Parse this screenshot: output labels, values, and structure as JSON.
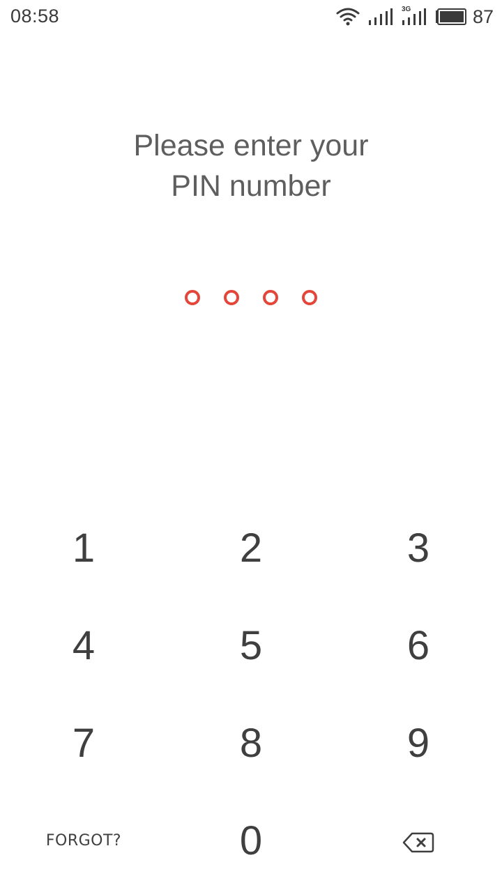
{
  "status_bar": {
    "time": "08:58",
    "battery_percent": "87",
    "network_label": "3G",
    "icons": [
      "wifi-icon",
      "signal-icon",
      "signal-3g-icon",
      "battery-icon"
    ]
  },
  "prompt": {
    "line1": "Please enter your",
    "line2": "PIN number"
  },
  "pin": {
    "length": 4,
    "entered": 0,
    "dot_color": "#e2473a"
  },
  "keypad": {
    "keys": [
      "1",
      "2",
      "3",
      "4",
      "5",
      "6",
      "7",
      "8",
      "9"
    ],
    "zero": "0",
    "forgot_label": "FORGOT?",
    "backspace_icon": "backspace-icon"
  }
}
